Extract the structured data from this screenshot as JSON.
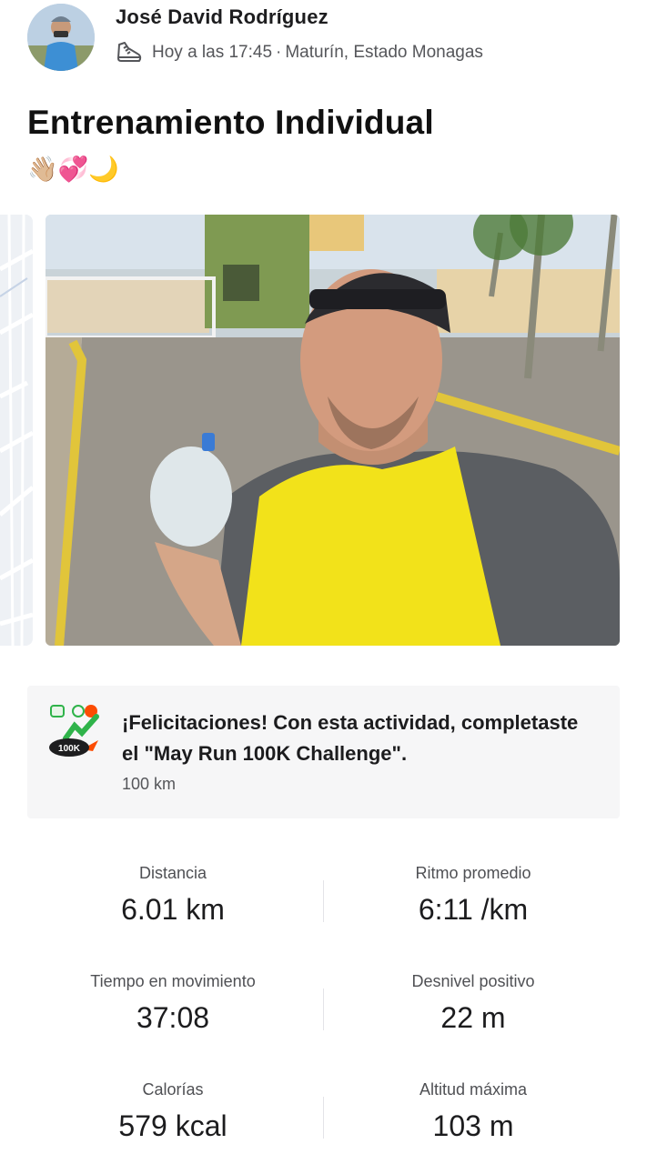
{
  "header": {
    "athlete_name": "José David Rodríguez",
    "time": "Hoy a las 17:45",
    "separator": "·",
    "location": "Maturín, Estado Monagas",
    "activity_icon": "shoe-icon"
  },
  "activity": {
    "title": "Entrenamiento Individual",
    "emojis": "👋🏼💞🌙"
  },
  "media": {
    "map_thumbnail": "route-map",
    "photo": "selfie-photo"
  },
  "challenge": {
    "message": "¡Felicitaciones! Con esta actividad, completaste el \"May Run 100K Challenge\".",
    "detail": "100 km",
    "badge_text": "100K",
    "badge_icon": "challenge-badge-icon"
  },
  "stats": [
    {
      "label": "Distancia",
      "value": "6.01 km"
    },
    {
      "label": "Ritmo promedio",
      "value": "6:11 /km"
    },
    {
      "label": "Tiempo en movimiento",
      "value": "37:08"
    },
    {
      "label": "Desnivel positivo",
      "value": "22 m"
    },
    {
      "label": "Calorías",
      "value": "579 kcal"
    },
    {
      "label": "Altitud máxima",
      "value": "103 m"
    }
  ],
  "colors": {
    "accent_orange": "#fc4c02",
    "badge_green": "#2fb34a",
    "card_bg": "#f6f6f7"
  }
}
